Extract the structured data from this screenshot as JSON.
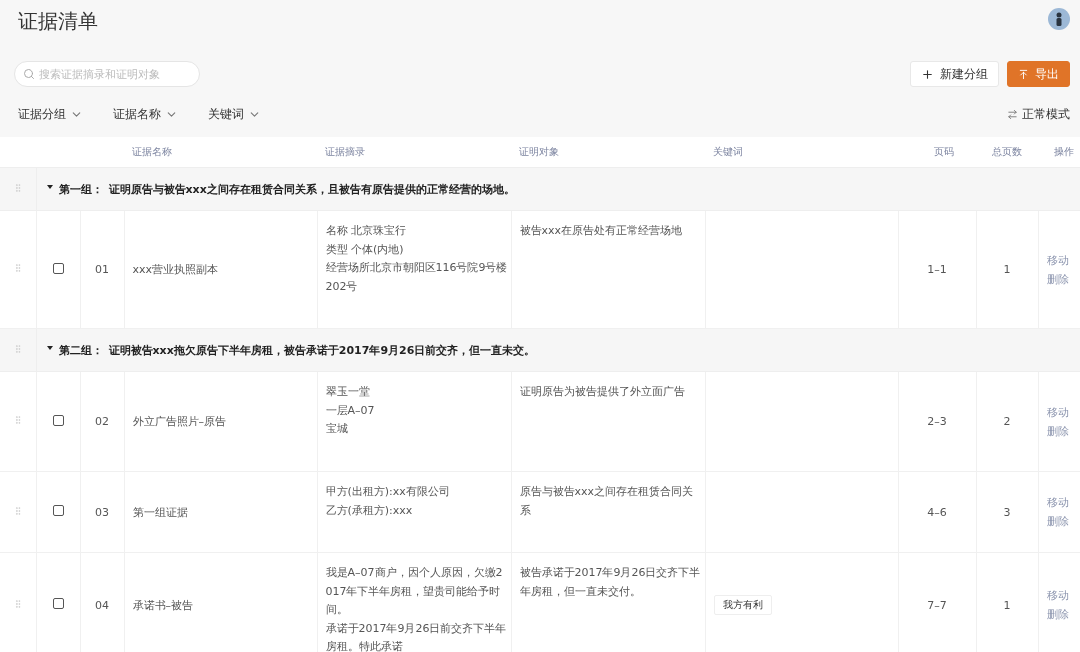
{
  "page": {
    "title": "证据清单"
  },
  "search": {
    "placeholder": "搜索证据摘录和证明对象"
  },
  "buttons": [
    {
      "kind": "plus",
      "label": "新建分组"
    },
    {
      "kind": "export",
      "label": "导出"
    }
  ],
  "filters": [
    {
      "label": "证据分组"
    },
    {
      "label": "证据名称"
    },
    {
      "label": "关键词"
    }
  ],
  "mode_toggle": {
    "label": "正常模式"
  },
  "table": {
    "columns": [
      "证据名称",
      "证据摘录",
      "证明对象",
      "关键词",
      "页码",
      "总页数",
      "操作"
    ],
    "groups": [
      {
        "expanded": true,
        "label": "第一组：",
        "title": "证明原告与被告xxx之间存在租赁合同关系，且被告有原告提供的正常经营的场地。",
        "rows": [
          {
            "checked": false,
            "number": "01",
            "name": "xxx营业执照副本",
            "excerpt": [
              "名称  北京珠宝行",
              "类型  个体(内地)",
              "经营场所北京市朝阳区116号院9号楼",
              "202号"
            ],
            "object": [
              "被告xxx在原告处有正常经营场地"
            ],
            "keywords": [],
            "pages": "1–1",
            "total": "1",
            "actions": [
              "移动",
              "删除"
            ]
          }
        ]
      },
      {
        "expanded": true,
        "label": "第二组：",
        "title": "证明被告xxx拖欠原告下半年房租，被告承诺于2017年9月26日前交齐，但一直未交。",
        "rows": [
          {
            "checked": false,
            "number": "02",
            "name": "外立广告照片–原告",
            "excerpt": [
              "翠玉一堂",
              "一层A–07",
              "宝城"
            ],
            "object": [
              "证明原告为被告提供了外立面广告"
            ],
            "keywords": [],
            "pages": "2–3",
            "total": "2",
            "actions": [
              "移动",
              "删除"
            ]
          },
          {
            "checked": false,
            "number": "03",
            "name": "第一组证据",
            "excerpt": [
              "甲方(出租方):xx有限公司",
              "乙方(承租方):xxx"
            ],
            "object": [
              "原告与被告xxx之间存在租赁合同关",
              "系"
            ],
            "keywords": [],
            "pages": "4–6",
            "total": "3",
            "actions": [
              "移动",
              "删除"
            ]
          },
          {
            "checked": false,
            "number": "04",
            "name": "承诺书–被告",
            "excerpt": [
              "我是A–07商户，因个人原因，欠缴2",
              "017年下半年房租，望贵司能给予时",
              "间。",
              "承诺于2017年9月26日前交齐下半年",
              "房租。特此承诺"
            ],
            "object": [
              "被告承诺于2017年9月26日交齐下半",
              "年房租，但一直未交付。"
            ],
            "keywords": [
              "我方有利"
            ],
            "pages": "7–7",
            "total": "1",
            "actions": [
              "移动",
              "删除"
            ]
          }
        ]
      }
    ]
  }
}
